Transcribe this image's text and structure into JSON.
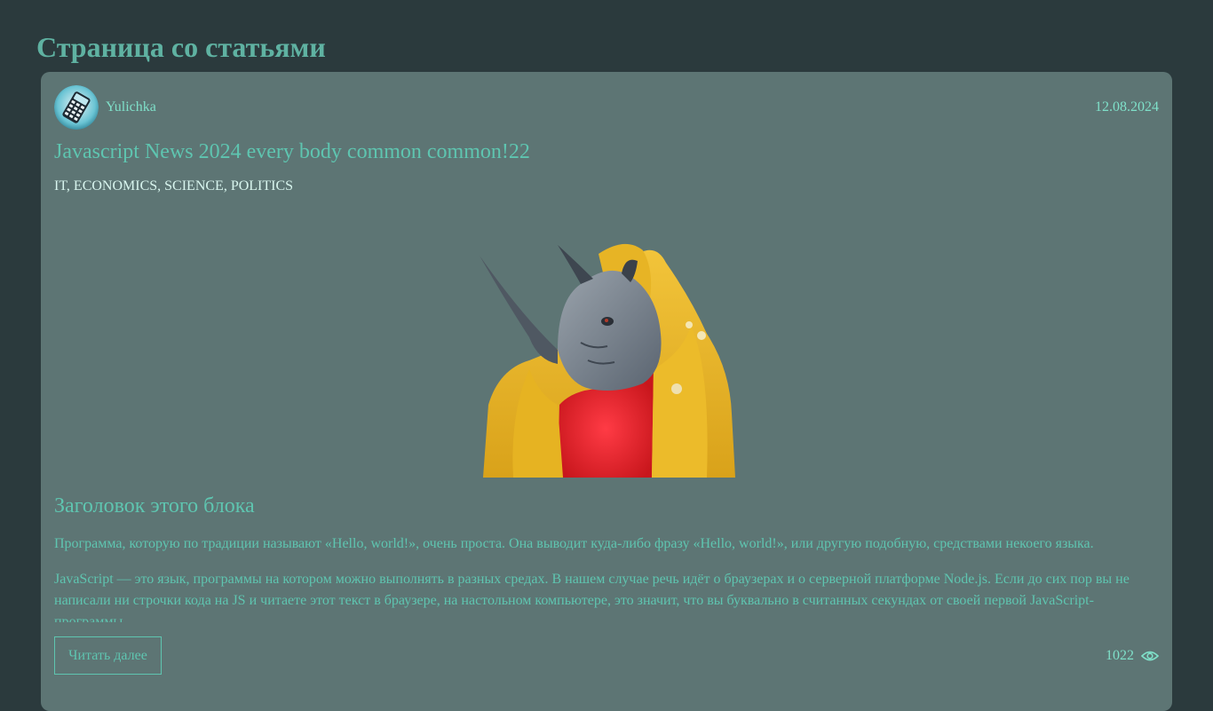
{
  "page": {
    "title": "Страница со статьями"
  },
  "article": {
    "author": "Yulichka",
    "date": "12.08.2024",
    "title": "Javascript News 2024 every body common common!22",
    "tags": "IT, ECONOMICS, SCIENCE, POLITICS",
    "block_title": "Заголовок этого блока",
    "paragraphs": [
      "Программа, которую по традиции называют «Hello, world!», очень проста. Она выводит куда-либо фразу «Hello, world!», или другую подобную, средствами некоего языка.",
      "JavaScript — это язык, программы на котором можно выполнять в разных средах. В нашем случае речь идёт о браузерах и о серверной платформе Node.js. Если до сих пор вы не написали ни строчки кода на JS и читаете этот текст в браузере, на настольном компьютере, это значит, что вы буквально в считанных секундах от своей первой JavaScript-программы."
    ],
    "read_more_label": "Читать далее",
    "views": "1022"
  },
  "icons": {
    "avatar": "calculator-phone-avatar",
    "views": "eye-icon"
  },
  "colors": {
    "background": "#2b3a3d",
    "card": "#5d7574",
    "accent": "#5ec5b0",
    "title": "#5fb2a2"
  }
}
